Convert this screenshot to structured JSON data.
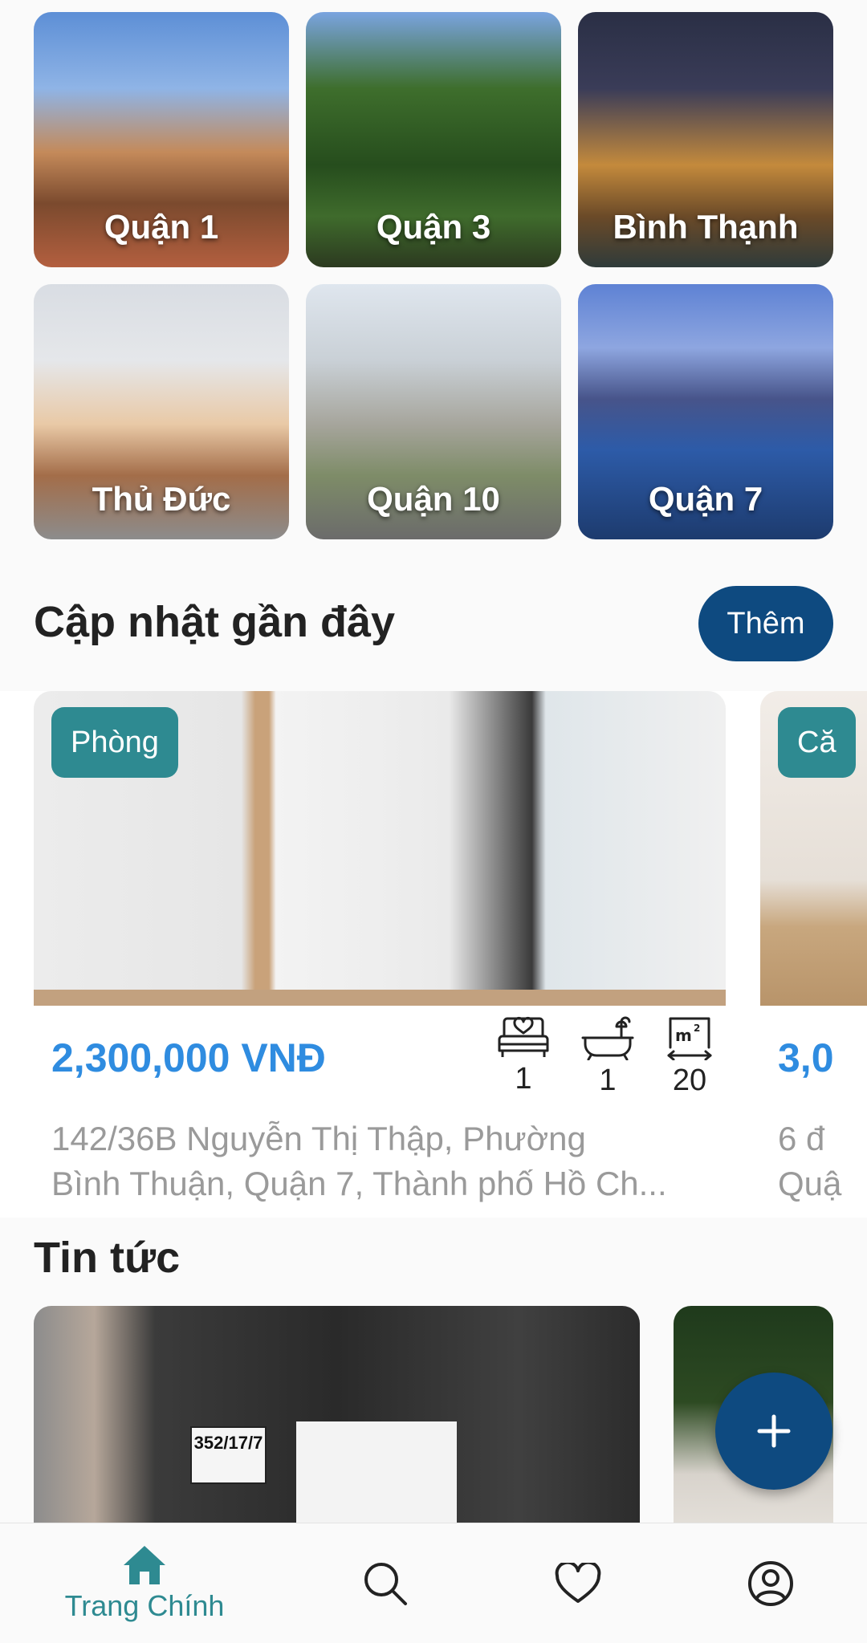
{
  "districts": [
    {
      "label": "Quận 1"
    },
    {
      "label": "Quận 3"
    },
    {
      "label": "Bình Thạnh"
    },
    {
      "label": "Thủ Đức"
    },
    {
      "label": "Quận 10"
    },
    {
      "label": "Quận 7"
    }
  ],
  "recent": {
    "title": "Cập nhật gần đây",
    "more_label": "Thêm",
    "listings": [
      {
        "tag": "Phòng",
        "price": "2,300,000 VNĐ",
        "bedrooms": "1",
        "bathrooms": "1",
        "area": "20",
        "address_line1": "142/36B Nguyễn Thị Thập, Phường",
        "address_line2": "Bình Thuận, Quận 7, Thành phố Hồ Ch..."
      },
      {
        "tag": "Că",
        "price": "3,0",
        "address_line1": "6 đ",
        "address_line2": "Quậ"
      }
    ]
  },
  "news": {
    "title": "Tin tức",
    "sign_text": "352/17/7"
  },
  "bottom_nav": {
    "home_label": "Trang Chính"
  },
  "colors": {
    "primary": "#0e4a80",
    "teal": "#2e8a91",
    "price": "#2f8ce0"
  }
}
